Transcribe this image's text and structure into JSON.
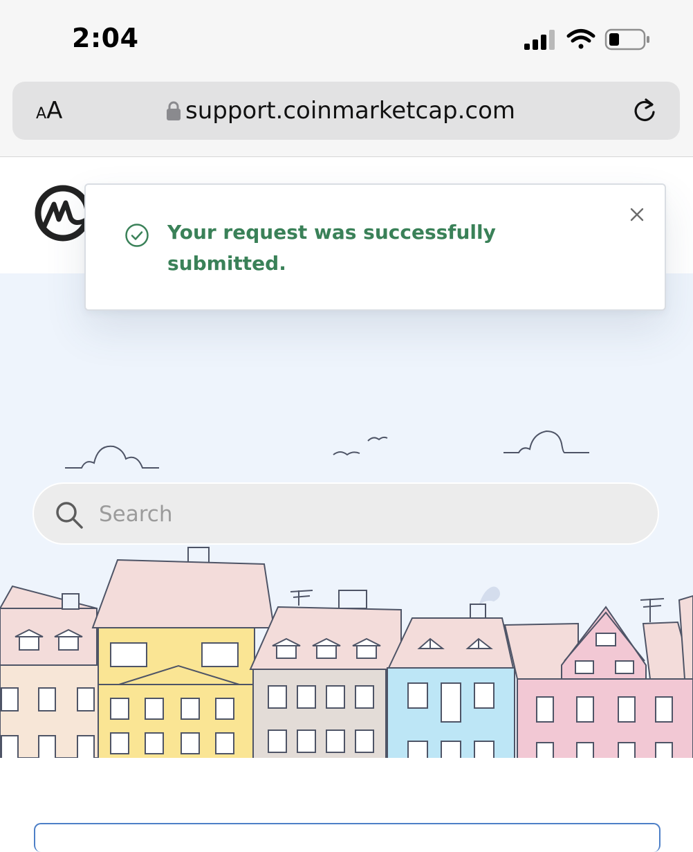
{
  "status_bar": {
    "time": "2:04",
    "icons": [
      "cellular-signal-icon",
      "wifi-icon",
      "battery-icon"
    ]
  },
  "browser": {
    "text_size_button": {
      "small": "A",
      "large": "A"
    },
    "url": "support.coinmarketcap.com",
    "icons": [
      "lock-icon",
      "reload-icon"
    ]
  },
  "page": {
    "logo": "coinmarketcap-logo",
    "search": {
      "placeholder": "Search",
      "value": ""
    }
  },
  "toast": {
    "message": "Your request was successfully submitted.",
    "icons": [
      "check-circle-icon",
      "close-icon"
    ]
  },
  "colors": {
    "success_green": "#3a8158",
    "hero_background": "#eef4fc",
    "url_bar": "#e2e2e3",
    "link_blue": "#4d7fc7"
  }
}
